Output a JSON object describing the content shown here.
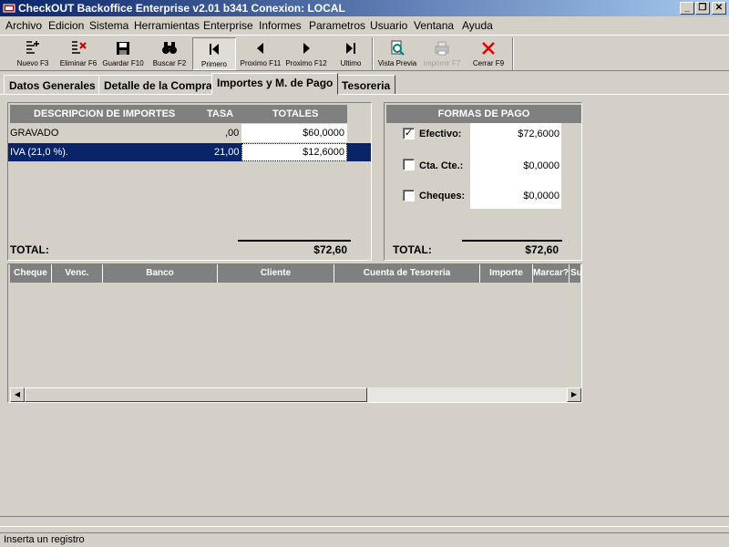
{
  "window": {
    "title": "CheckOUT Backoffice Enterprise v2.01 b341 Conexion: LOCAL",
    "minimize_icon": "minimize-icon",
    "restore_icon": "restore-icon",
    "close_icon": "close-icon"
  },
  "menu": [
    "Archivo",
    "Edicion",
    "Sistema",
    "Herramientas",
    "Enterprise",
    "Informes",
    "Parametros",
    "Usuario",
    "Ventana",
    "Ayuda"
  ],
  "toolbar": {
    "nuevo": "Nuevo F3",
    "eliminar": "Eliminar F6",
    "guardar": "Guardar F10",
    "buscar": "Buscar F2",
    "primero": "Primero",
    "proximo11": "Proximo F11",
    "proximo12": "Proximo F12",
    "ultimo": "Ultimo",
    "vista_previa": "Vista Previa",
    "imprimir": "Imprimir F7",
    "cerrar": "Cerrar F9"
  },
  "tabs": [
    "Datos Generales",
    "Detalle de la Compra",
    "Importes y M. de Pago",
    "Tesoreria"
  ],
  "importes": {
    "headers": {
      "descripcion": "DESCRIPCION DE IMPORTES",
      "tasa": "TASA",
      "totales": "TOTALES"
    },
    "rows": [
      {
        "descripcion": "GRAVADO",
        "tasa": ",00",
        "total": "$60,0000"
      },
      {
        "descripcion": "IVA  (21,0 %).",
        "tasa": "21,00",
        "total": "$12,6000"
      }
    ],
    "total_label": "TOTAL:",
    "total_value": "$72,60"
  },
  "formas_pago": {
    "header": "FORMAS DE PAGO",
    "items": [
      {
        "label": "Efectivo:",
        "checked": "✓",
        "value": "$72,6000"
      },
      {
        "label": "Cta. Cte.:",
        "checked": "",
        "value": "$0,0000"
      },
      {
        "label": "Cheques:",
        "checked": "",
        "value": "$0,0000"
      }
    ],
    "total_label": "TOTAL:",
    "total_value": "$72,60"
  },
  "cheques_grid": {
    "columns": [
      "Cheque",
      "Venc.",
      "Banco",
      "Cliente",
      "Cuenta de Tesoreria",
      "Importe",
      "Marcar?",
      "Suc"
    ]
  },
  "status": {
    "text": "Inserta un registro"
  },
  "colors": {
    "selection": "#0a246a",
    "header_bg": "#808080",
    "window_bg": "#d4d0c8"
  }
}
